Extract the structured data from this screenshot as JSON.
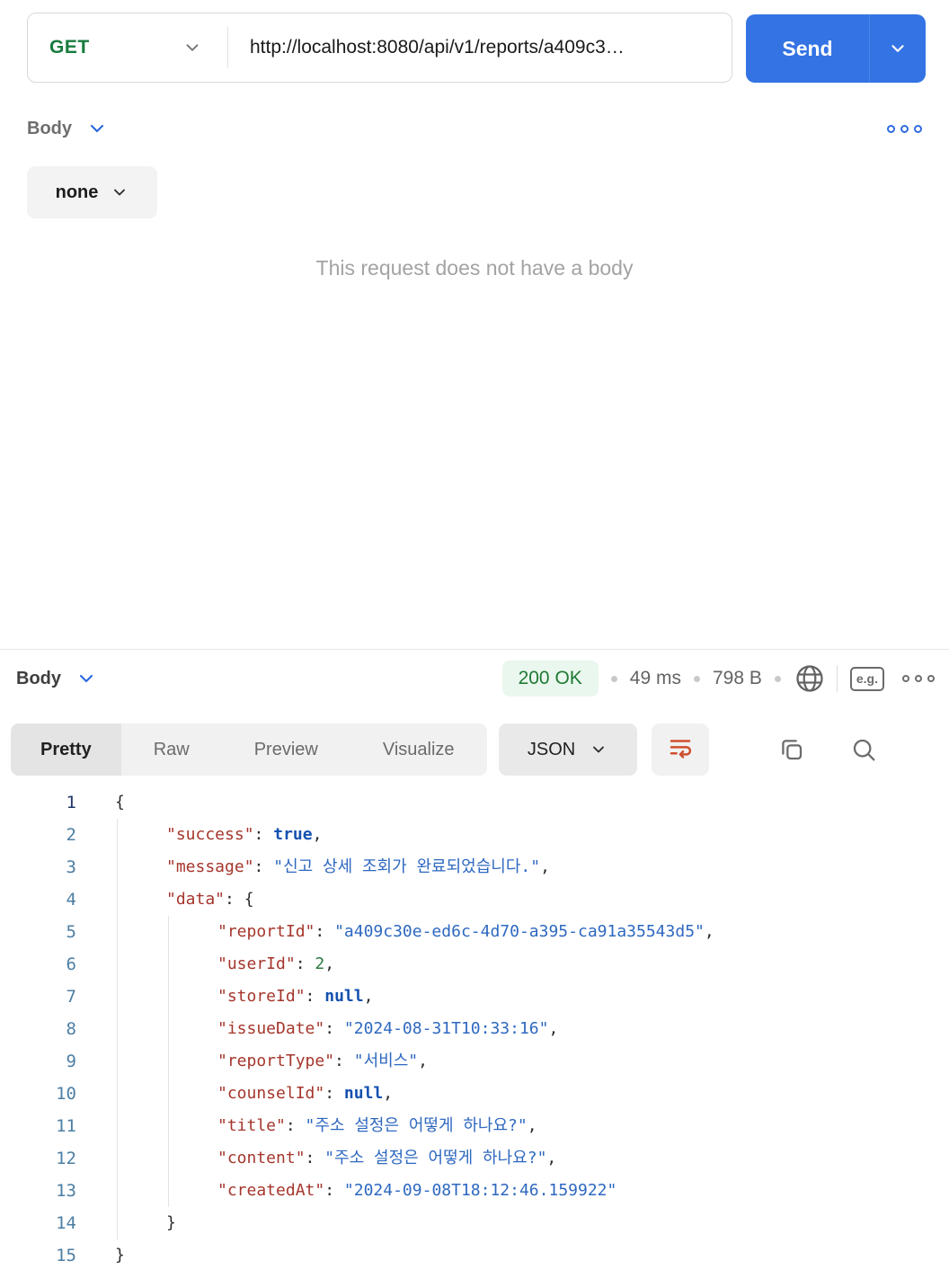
{
  "request": {
    "method": "GET",
    "url": "http://localhost:8080/api/v1/reports/a409c3…",
    "send_label": "Send",
    "body_section_label": "Body",
    "body_type_selected": "none",
    "empty_body_message": "This request does not have a body"
  },
  "response": {
    "section_label": "Body",
    "status": "200 OK",
    "time": "49 ms",
    "size": "798 B",
    "eg_label": "e.g.",
    "tabs": [
      "Pretty",
      "Raw",
      "Preview",
      "Visualize"
    ],
    "active_tab": "Pretty",
    "format_selected": "JSON"
  },
  "colors": {
    "accent_blue": "#2f6bdf",
    "send_blue": "#3473e3",
    "method_green": "#177b3d",
    "status_green": "#1f7a34",
    "status_green_bg": "#eaf7ee",
    "wrap_icon_orange": "#cf4f2e",
    "code_key": "#a5362c",
    "code_string": "#2e68c0",
    "code_keyword": "#1351b0",
    "code_number": "#2c7a3f"
  },
  "code": {
    "lines": [
      {
        "num": 1,
        "ind": 0,
        "active": true,
        "tokens": [
          [
            "p",
            "{"
          ]
        ]
      },
      {
        "num": 2,
        "ind": 1,
        "tokens": [
          [
            "k",
            "\"success\""
          ],
          [
            "p",
            ": "
          ],
          [
            "b",
            "true"
          ],
          [
            "p",
            ","
          ]
        ]
      },
      {
        "num": 3,
        "ind": 1,
        "tokens": [
          [
            "k",
            "\"message\""
          ],
          [
            "p",
            ": "
          ],
          [
            "s",
            "\"신고 상세 조회가 완료되었습니다.\""
          ],
          [
            "p",
            ","
          ]
        ]
      },
      {
        "num": 4,
        "ind": 1,
        "tokens": [
          [
            "k",
            "\"data\""
          ],
          [
            "p",
            ": {"
          ]
        ]
      },
      {
        "num": 5,
        "ind": 2,
        "tokens": [
          [
            "k",
            "\"reportId\""
          ],
          [
            "p",
            ": "
          ],
          [
            "s",
            "\"a409c30e-ed6c-4d70-a395-ca91a35543d5\""
          ],
          [
            "p",
            ","
          ]
        ]
      },
      {
        "num": 6,
        "ind": 2,
        "tokens": [
          [
            "k",
            "\"userId\""
          ],
          [
            "p",
            ": "
          ],
          [
            "n",
            "2"
          ],
          [
            "p",
            ","
          ]
        ]
      },
      {
        "num": 7,
        "ind": 2,
        "tokens": [
          [
            "k",
            "\"storeId\""
          ],
          [
            "p",
            ": "
          ],
          [
            "b",
            "null"
          ],
          [
            "p",
            ","
          ]
        ]
      },
      {
        "num": 8,
        "ind": 2,
        "tokens": [
          [
            "k",
            "\"issueDate\""
          ],
          [
            "p",
            ": "
          ],
          [
            "s",
            "\"2024-08-31T10:33:16\""
          ],
          [
            "p",
            ","
          ]
        ]
      },
      {
        "num": 9,
        "ind": 2,
        "tokens": [
          [
            "k",
            "\"reportType\""
          ],
          [
            "p",
            ": "
          ],
          [
            "s",
            "\"서비스\""
          ],
          [
            "p",
            ","
          ]
        ]
      },
      {
        "num": 10,
        "ind": 2,
        "tokens": [
          [
            "k",
            "\"counselId\""
          ],
          [
            "p",
            ": "
          ],
          [
            "b",
            "null"
          ],
          [
            "p",
            ","
          ]
        ]
      },
      {
        "num": 11,
        "ind": 2,
        "tokens": [
          [
            "k",
            "\"title\""
          ],
          [
            "p",
            ": "
          ],
          [
            "s",
            "\"주소 설정은 어떻게 하나요?\""
          ],
          [
            "p",
            ","
          ]
        ]
      },
      {
        "num": 12,
        "ind": 2,
        "tokens": [
          [
            "k",
            "\"content\""
          ],
          [
            "p",
            ": "
          ],
          [
            "s",
            "\"주소 설정은 어떻게 하나요?\""
          ],
          [
            "p",
            ","
          ]
        ]
      },
      {
        "num": 13,
        "ind": 2,
        "tokens": [
          [
            "k",
            "\"createdAt\""
          ],
          [
            "p",
            ": "
          ],
          [
            "s",
            "\"2024-09-08T18:12:46.159922\""
          ]
        ]
      },
      {
        "num": 14,
        "ind": 1,
        "tokens": [
          [
            "p",
            "}"
          ]
        ]
      },
      {
        "num": 15,
        "ind": 0,
        "tokens": [
          [
            "p",
            "}"
          ]
        ]
      }
    ]
  }
}
